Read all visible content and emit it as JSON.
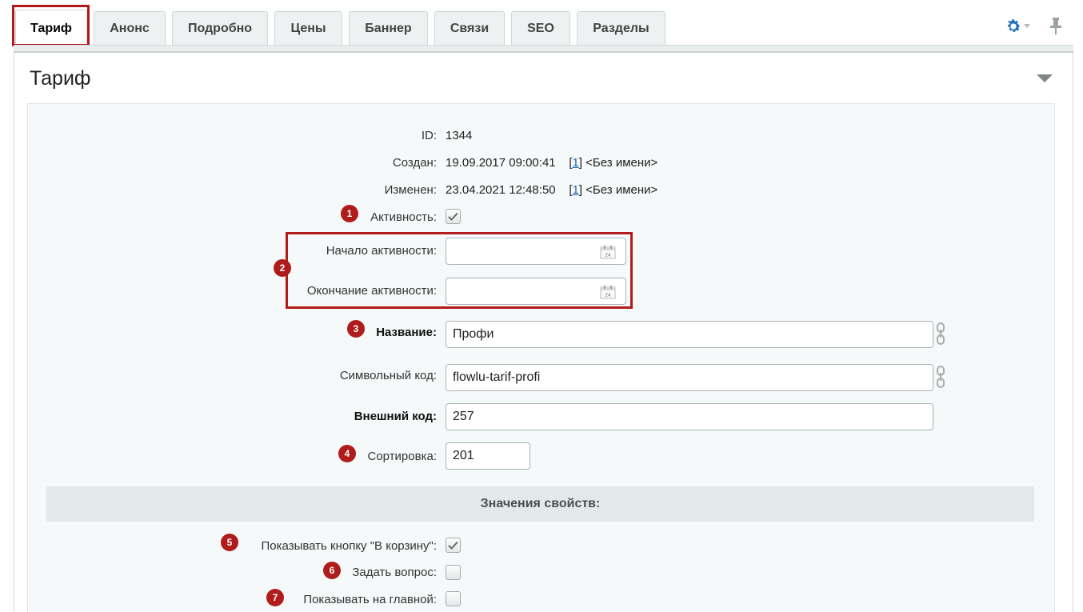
{
  "tabs": [
    {
      "label": "Тариф",
      "active": true
    },
    {
      "label": "Анонс"
    },
    {
      "label": "Подробно"
    },
    {
      "label": "Цены"
    },
    {
      "label": "Баннер"
    },
    {
      "label": "Связи"
    },
    {
      "label": "SEO"
    },
    {
      "label": "Разделы"
    }
  ],
  "icons": {
    "settings": "gear-icon",
    "pin": "pin-icon",
    "collapse": "triangle-down-icon",
    "calendar": "calendar-icon",
    "translit": "link-icon"
  },
  "colors": {
    "accent": "#b31b1b",
    "gear": "#1e6fc0"
  },
  "panel": {
    "title": "Тариф"
  },
  "fields": {
    "id_label": "ID:",
    "id_value": "1344",
    "created_label": "Создан:",
    "created_value": "19.09.2017 09:00:41",
    "created_user_open": "[",
    "created_user_id": "1",
    "created_user_close": "]",
    "created_user_name": "<Без имени>",
    "modified_label": "Изменен:",
    "modified_value": "23.04.2021 12:48:50",
    "modified_user_open": "[",
    "modified_user_id": "1",
    "modified_user_close": "]",
    "modified_user_name": "<Без имени>",
    "active_label": "Активность:",
    "active_checked": true,
    "active_from_label": "Начало активности:",
    "active_from_value": "",
    "active_to_label": "Окончание активности:",
    "active_to_value": "",
    "name_label": "Название:",
    "name_value": "Профи",
    "code_label": "Символьный код:",
    "code_value": "flowlu-tarif-profi",
    "xml_id_label": "Внешний код:",
    "xml_id_value": "257",
    "sort_label": "Сортировка:",
    "sort_value": "201"
  },
  "properties": {
    "header": "Значения свойств:",
    "basket_label": "Показывать кнопку \"В корзину\":",
    "basket_checked": true,
    "question_label": "Задать вопрос:",
    "question_checked": false,
    "main_label": "Показывать на главной:",
    "main_checked": false
  },
  "calendar_day": "24",
  "badges": [
    "1",
    "2",
    "3",
    "4",
    "5",
    "6",
    "7"
  ]
}
